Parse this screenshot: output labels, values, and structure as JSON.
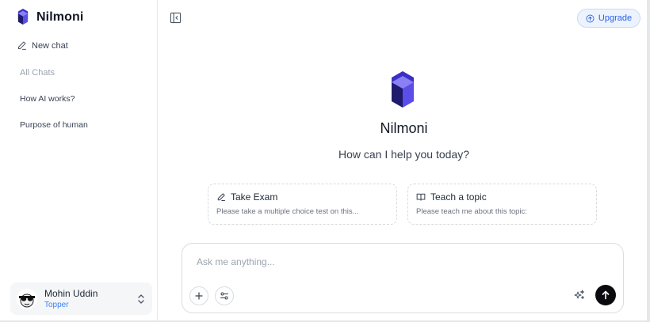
{
  "sidebar": {
    "brand_name": "Nilmoni",
    "new_chat_label": "New chat",
    "section_label": "All Chats",
    "chats": [
      {
        "label": "How AI works?"
      },
      {
        "label": "Purpose of human"
      }
    ],
    "user": {
      "name": "Mohin Uddin",
      "badge": "Topper"
    }
  },
  "header": {
    "upgrade_label": "Upgrade"
  },
  "main": {
    "title": "Nilmoni",
    "subtitle": "How can I help you today?",
    "prompts": [
      {
        "title": "Take Exam",
        "description": "Please take a multiple choice test on this..."
      },
      {
        "title": "Teach a topic",
        "description": "Please teach me about this topic:"
      }
    ]
  },
  "composer": {
    "placeholder": "Ask me anything..."
  },
  "colors": {
    "accent": "#2563eb",
    "logo_dark": "#1e1b6e",
    "logo_light": "#6d5df0",
    "send_button": "#0b0b0f"
  },
  "icons": {
    "brand": "nilmoni-logo-icon",
    "new_chat": "pencil-icon",
    "toggle": "sidebar-toggle-icon",
    "upgrade": "arrow-up-circle-icon",
    "exam": "pencil-icon",
    "teach": "book-open-icon",
    "attach": "plus-icon",
    "tools": "sliders-icon",
    "enhance": "sparkle-icon",
    "send": "arrow-up-icon",
    "user_menu": "chevron-up-down-icon"
  }
}
